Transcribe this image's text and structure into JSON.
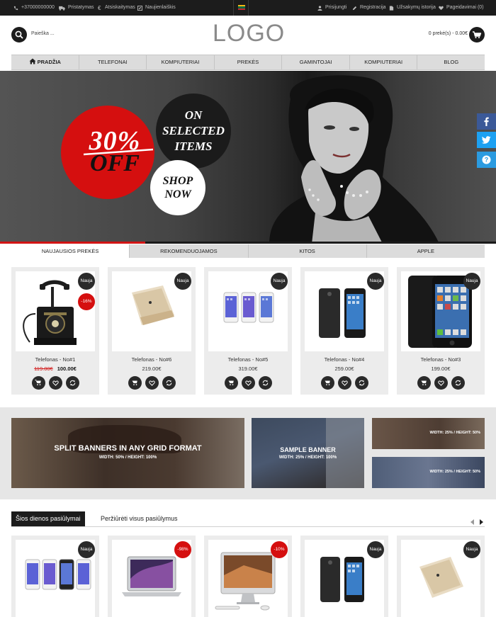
{
  "topbar": {
    "phone": "+37000000000",
    "shipping": "Pristatymas",
    "payment": "Atsiskaitymas",
    "news": "Naujienlaiškis",
    "login": "Prisijungti",
    "register": "Registracija",
    "orders": "Užsakymų istorija",
    "wishlist": "Pageidavimai (0)"
  },
  "header": {
    "search_placeholder": "Paieška ...",
    "logo": "LOGO",
    "cart": "0 prekė(s) - 0.00€"
  },
  "nav": [
    "PRADŽIA",
    "TELEFONAI",
    "KOMPIUTERIAI",
    "PREKĖS",
    "GAMINTOJAI",
    "KOMPIUTERIAI",
    "BLOG"
  ],
  "hero": {
    "discount_big": "30%",
    "discount_off": "OFF",
    "on_selected": "ON SELECTED ITEMS",
    "shop_now": "SHOP NOW"
  },
  "tabs": [
    "NAUJAUSIOS PREKĖS",
    "REKOMENDUOJAMOS",
    "KITOS",
    "APPLE"
  ],
  "products": [
    {
      "name": "Telefonas - No#1",
      "old_price": "119.00€",
      "price": "100.00€",
      "badge": "Nauja",
      "sale": "-16%"
    },
    {
      "name": "Telefonas - No#6",
      "old_price": "",
      "price": "219.00€",
      "badge": "Nauja",
      "sale": ""
    },
    {
      "name": "Telefonas - No#5",
      "old_price": "",
      "price": "319.00€",
      "badge": "Nauja",
      "sale": ""
    },
    {
      "name": "Telefonas - No#4",
      "old_price": "",
      "price": "259.00€",
      "badge": "Nauja",
      "sale": ""
    },
    {
      "name": "Telefonas - No#3",
      "old_price": "",
      "price": "199.00€",
      "badge": "Nauja",
      "sale": ""
    }
  ],
  "banners": {
    "split_title": "SPLIT BANNERS IN ANY GRID FORMAT",
    "split_sub": "WIDTH: 50%  /  HEIGHT: 100%",
    "sample_title": "SAMPLE BANNER",
    "sample_sub": "WIDTH: 25%  /  HEIGHT: 100%",
    "small1": "WIDTH: 25%  /  HEIGHT: 50%",
    "small2": "WIDTH: 25%  /  HEIGHT: 50%"
  },
  "deals": {
    "title": "Šios dienos pasiūlymai",
    "view_all": "Peržiūrėti visus pasiūlymus",
    "items": [
      {
        "badge": "Nauja",
        "sale": false
      },
      {
        "badge": "-98%",
        "sale": true
      },
      {
        "badge": "-10%",
        "sale": true
      },
      {
        "badge": "Nauja",
        "sale": false
      },
      {
        "badge": "Nauja",
        "sale": false
      }
    ]
  },
  "colors": {
    "accent_red": "#d21414",
    "dark": "#1c1c1c",
    "facebook": "#3b5998",
    "twitter": "#1da1f2",
    "help": "#2b9be0"
  },
  "icons": [
    "phone-icon",
    "truck-icon",
    "euro-icon",
    "newsletter-icon",
    "user-icon",
    "register-icon",
    "orders-icon",
    "heart-icon",
    "search-icon",
    "cart-icon",
    "home-icon",
    "facebook-icon",
    "twitter-icon",
    "help-icon",
    "heart-icon",
    "refresh-icon"
  ]
}
